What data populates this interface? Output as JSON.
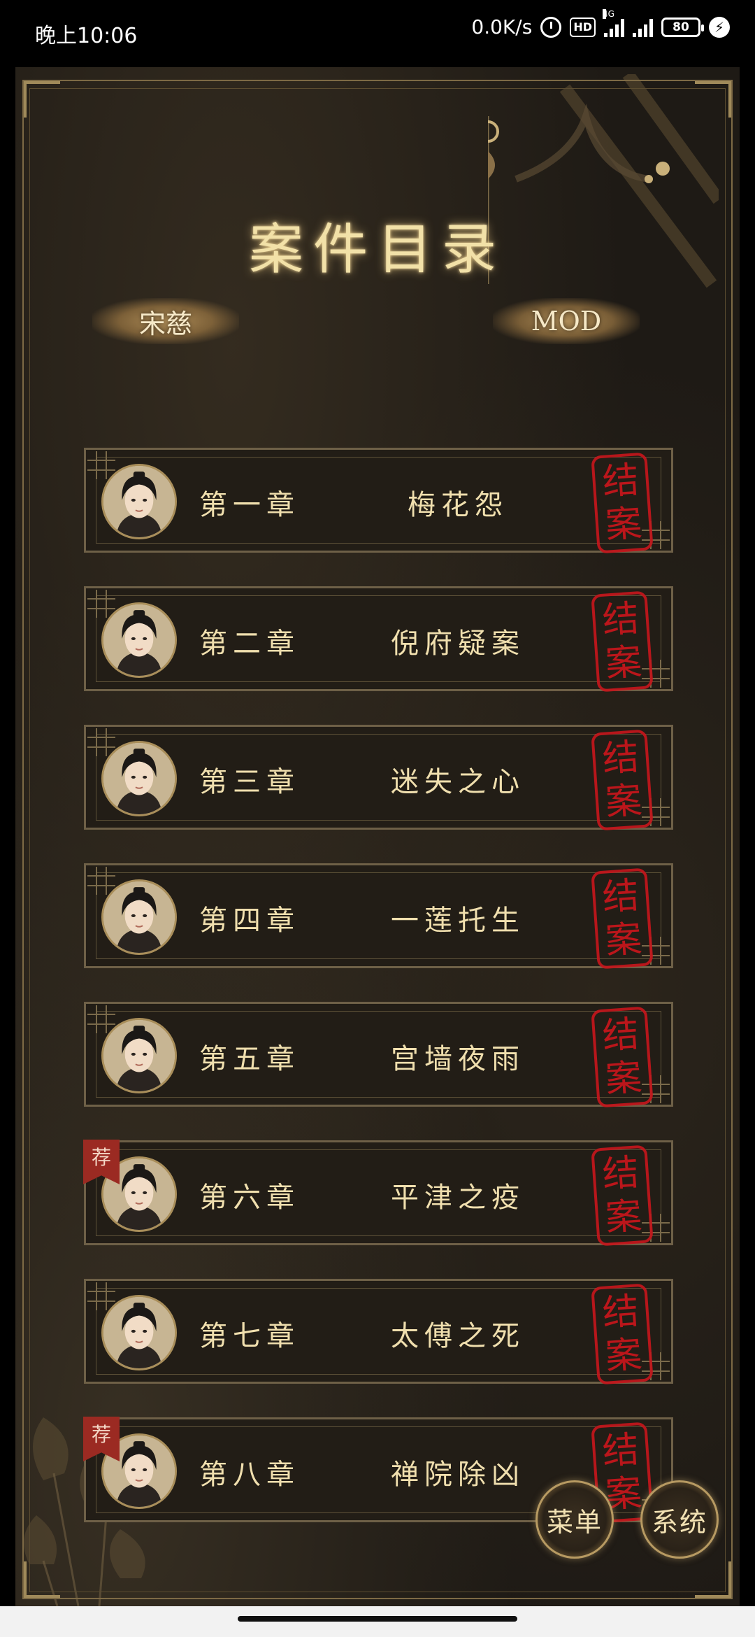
{
  "status_bar": {
    "time": "晚上10:06",
    "speed": "0.0K/s",
    "hd": "HD",
    "network": "4G",
    "battery": "80"
  },
  "title": "案件目录",
  "tabs": {
    "left": "宋慈",
    "right": "MOD"
  },
  "chapters": [
    {
      "num": "第一章",
      "title": "梅花怨",
      "stamp_top": "结",
      "stamp_bottom": "案",
      "recommended": ""
    },
    {
      "num": "第二章",
      "title": "倪府疑案",
      "stamp_top": "结",
      "stamp_bottom": "案",
      "recommended": ""
    },
    {
      "num": "第三章",
      "title": "迷失之心",
      "stamp_top": "结",
      "stamp_bottom": "案",
      "recommended": ""
    },
    {
      "num": "第四章",
      "title": "一莲托生",
      "stamp_top": "结",
      "stamp_bottom": "案",
      "recommended": ""
    },
    {
      "num": "第五章",
      "title": "宫墙夜雨",
      "stamp_top": "结",
      "stamp_bottom": "案",
      "recommended": ""
    },
    {
      "num": "第六章",
      "title": "平津之疫",
      "stamp_top": "结",
      "stamp_bottom": "案",
      "recommended": "荐"
    },
    {
      "num": "第七章",
      "title": "太傅之死",
      "stamp_top": "结",
      "stamp_bottom": "案",
      "recommended": ""
    },
    {
      "num": "第八章",
      "title": "禅院除凶",
      "stamp_top": "结",
      "stamp_bottom": "案",
      "recommended": "荐"
    }
  ],
  "buttons": {
    "menu": "菜单",
    "system": "系统"
  },
  "colors": {
    "gold_text": "#f0dfae",
    "stamp_red": "#c4161c",
    "badge_red": "#9b2a22",
    "panel_bg": "#221d16"
  }
}
